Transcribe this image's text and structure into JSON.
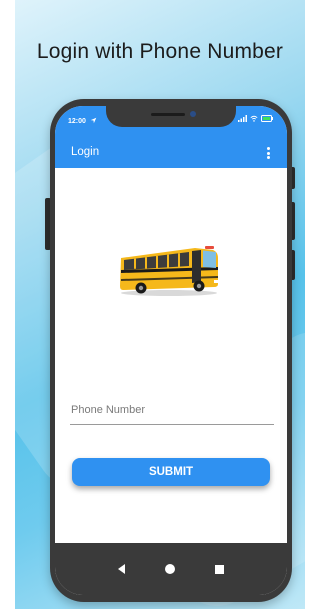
{
  "promo": {
    "title": "Login with Phone Number"
  },
  "status_bar": {
    "time": "12:00",
    "icons": [
      "location-arrow-icon",
      "signal-icon",
      "wifi-icon",
      "battery-icon"
    ]
  },
  "app_bar": {
    "title": "Login",
    "menu_icon": "more-vert-icon"
  },
  "illustration": {
    "icon": "school-bus-icon"
  },
  "form": {
    "phone_placeholder": "Phone Number",
    "phone_value": "",
    "submit_label": "SUBMIT"
  },
  "nav_bar": {
    "icons": [
      "back-icon",
      "home-icon",
      "recents-icon"
    ]
  },
  "colors": {
    "accent": "#2f91f1",
    "phone_body": "#3a3a3a",
    "bus_yellow": "#f5b81b",
    "background": "#57c2ea"
  }
}
